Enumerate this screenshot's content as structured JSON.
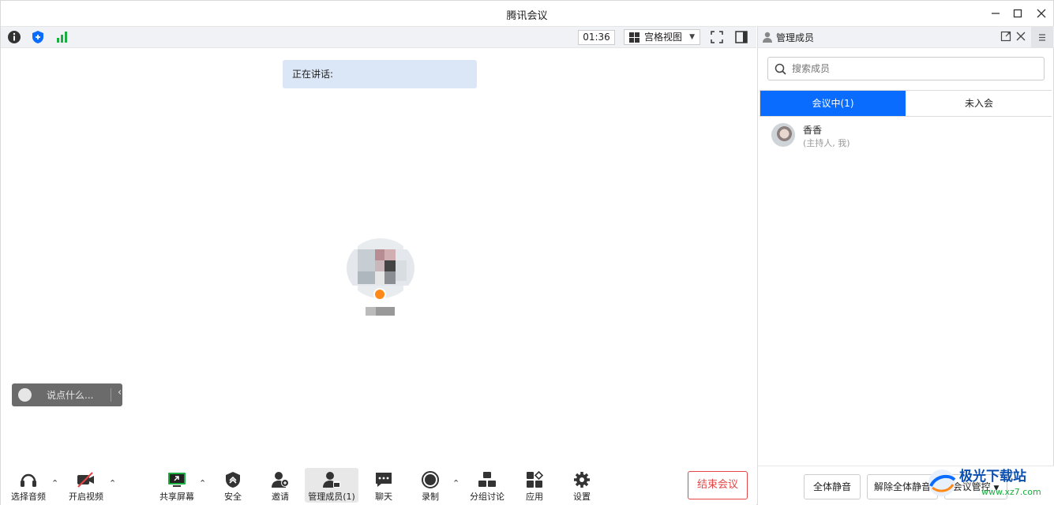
{
  "window": {
    "title": "腾讯会议"
  },
  "topbar": {
    "timer": "01:36",
    "view_label": "宫格视图"
  },
  "main": {
    "speaking_label": "正在讲话:",
    "chat_placeholder": "说点什么..."
  },
  "toolbar": {
    "audio": "选择音频",
    "video": "开启视频",
    "share": "共享屏幕",
    "security": "安全",
    "invite": "邀请",
    "members": "管理成员(1)",
    "chat": "聊天",
    "record": "录制",
    "breakout": "分组讨论",
    "apps": "应用",
    "settings": "设置",
    "end": "结束会议"
  },
  "panel": {
    "title": "管理成员",
    "search_placeholder": "搜索成员",
    "tabs": [
      "会议中(1)",
      "未入会"
    ],
    "members": [
      {
        "name": "香香",
        "role": "(主持人, 我)"
      }
    ],
    "buttons": {
      "mute_all": "全体静音",
      "unmute_all": "解除全体静音",
      "manage": "会议管控"
    }
  },
  "watermark": {
    "text": "极光下载站",
    "url": "www.xz7.com"
  },
  "colors": {
    "accent": "#0a6cff",
    "end": "#e54545",
    "signal": "#1aad3f"
  }
}
